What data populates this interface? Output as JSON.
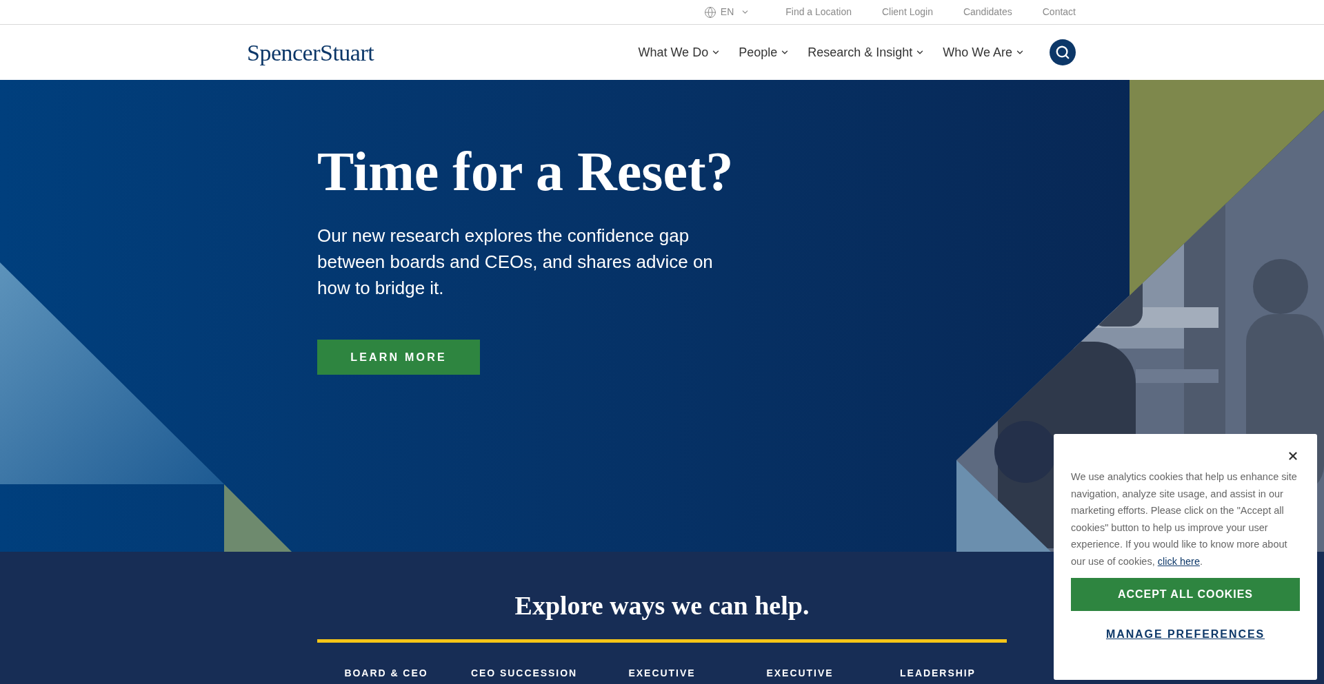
{
  "top_bar": {
    "language": "EN",
    "links": [
      "Find a Location",
      "Client Login",
      "Candidates",
      "Contact"
    ]
  },
  "header": {
    "logo": "SpencerStuart",
    "nav": [
      {
        "label": "What We Do"
      },
      {
        "label": "People"
      },
      {
        "label": "Research & Insight"
      },
      {
        "label": "Who We Are"
      }
    ]
  },
  "hero": {
    "title": "Time for a Reset?",
    "subtitle": "Our new research explores the confidence gap between boards and CEOs, and shares advice on how to bridge it.",
    "button": "LEARN MORE"
  },
  "explore": {
    "heading": "Explore ways we can help.",
    "tabs": [
      "BOARD & CEO",
      "CEO SUCCESSION",
      "EXECUTIVE",
      "EXECUTIVE",
      "LEADERSHIP"
    ]
  },
  "cookie_banner": {
    "text": "We use analytics cookies that help us enhance site navigation, analyze site usage, and assist in our marketing efforts. Please click on the \"Accept all cookies\" button to help us improve your user experience. If you would like to know more about our use of cookies, ",
    "link": "click here",
    "after_link": ".",
    "accept": "ACCEPT ALL COOKIES",
    "manage": "MANAGE PREFERENCES"
  }
}
